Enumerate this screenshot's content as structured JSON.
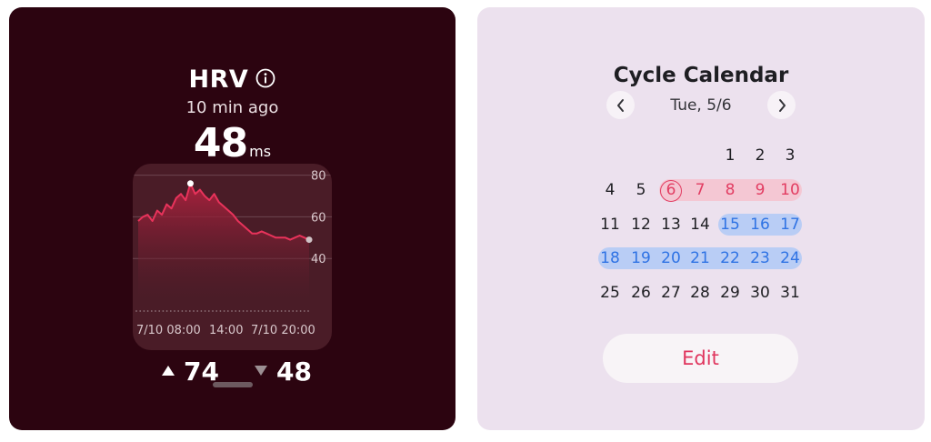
{
  "hrv": {
    "title": "HRV",
    "ago": "10 min ago",
    "value": "48",
    "unit": "ms",
    "max": "74",
    "min": "48",
    "colors": {
      "line": "#e8335b",
      "card": "#2c0410"
    }
  },
  "chart_data": {
    "type": "area",
    "y_ticks": [
      "80",
      "60",
      "40"
    ],
    "x_ticks": [
      "7/10 08:00",
      "14:00",
      "7/10 20:00"
    ],
    "ylim": [
      20,
      82
    ],
    "series": [
      {
        "values": [
          58,
          60,
          61,
          58,
          63,
          61,
          66,
          64,
          69,
          71,
          68,
          76,
          71,
          73,
          70,
          68,
          71,
          67,
          65,
          63,
          61,
          58,
          56,
          54,
          52,
          52,
          53,
          52,
          51,
          50,
          50,
          50,
          49,
          50,
          51,
          50,
          49
        ]
      }
    ],
    "peak_value": 76,
    "latest_value": 49,
    "grid": true
  },
  "calendar": {
    "title": "Cycle Calendar",
    "date_label": "Tue, 5/6",
    "nav_prev_icon": "chevron-left-icon",
    "nav_next_icon": "chevron-right-icon",
    "today": 6,
    "period_days": [
      6,
      7,
      8,
      9,
      10
    ],
    "fertile_days": [
      15,
      16,
      17,
      18,
      19,
      20,
      21,
      22,
      23,
      24
    ],
    "weeks": [
      [
        "",
        "",
        "",
        "",
        "1",
        "2",
        "3"
      ],
      [
        "4",
        "5",
        "6",
        "7",
        "8",
        "9",
        "10"
      ],
      [
        "11",
        "12",
        "13",
        "14",
        "15",
        "16",
        "17"
      ],
      [
        "18",
        "19",
        "20",
        "21",
        "22",
        "23",
        "24"
      ],
      [
        "25",
        "26",
        "27",
        "28",
        "29",
        "30",
        "31"
      ]
    ],
    "edit_label": "Edit",
    "colors": {
      "period": "#e23d62",
      "period_bg": "#f4c7d3",
      "fertile": "#2f73e4",
      "fertile_bg": "#b9cdf5"
    }
  }
}
